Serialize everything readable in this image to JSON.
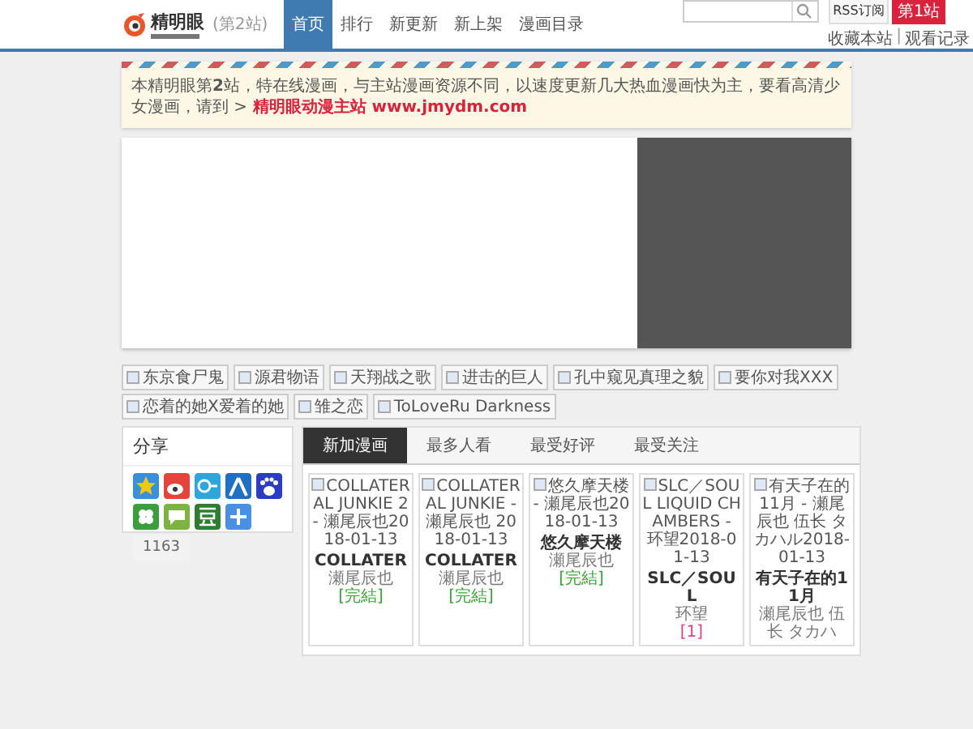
{
  "logo": {
    "name": "精明眼",
    "station": "(第2站)"
  },
  "nav": [
    {
      "label": "首页",
      "selected": true
    },
    {
      "label": "排行",
      "selected": false
    },
    {
      "label": "新更新",
      "selected": false
    },
    {
      "label": "新上架",
      "selected": false
    },
    {
      "label": "漫画目录",
      "selected": false
    }
  ],
  "header_links": {
    "rss": "RSS订阅",
    "station": "第1站",
    "links": [
      "收藏本站",
      "观看记录"
    ],
    "separator": "|"
  },
  "notice": {
    "text": "本精明眼第**2**站，特在线漫画，与主站漫画资源不同，以速度更新几大热血漫画快为主，要看高清少女漫画，请到 >",
    "link": "精明眼动漫主站 www.jmydm.com"
  },
  "strip": [
    "东京食尸鬼",
    "源君物语",
    "天翔战之歌",
    "进击的巨人",
    "孔中窥见真理之貌",
    "要你对我XXX",
    "恋着的她X爱着的她",
    "雏之恋",
    "ToLoveRu Darkness"
  ],
  "share": {
    "title": "分享",
    "icons": [
      {
        "kind": "star"
      },
      {
        "kind": "weibo"
      },
      {
        "kind": "tencent"
      },
      {
        "kind": "renren"
      },
      {
        "kind": "baidu"
      },
      {
        "kind": "clover"
      },
      {
        "kind": "chat"
      },
      {
        "kind": "douban"
      },
      {
        "kind": "plus"
      }
    ],
    "count": "1163"
  },
  "tabs": [
    {
      "label": "新加漫画",
      "selected": true
    },
    {
      "label": "最多人看",
      "selected": false
    },
    {
      "label": "最受好评",
      "selected": false
    },
    {
      "label": "最受关注",
      "selected": false
    }
  ],
  "cards": [
    {
      "alt": "COLLATERAL JUNKIE 2 - 瀬尾辰也2018-01-13",
      "title": "COLLATER",
      "author": "瀬尾辰也",
      "status": "[完結]",
      "kind": "finished"
    },
    {
      "alt": "COLLATERAL JUNKIE - 瀬尾辰也 2018-01-13",
      "title": "COLLATER",
      "author": "瀬尾辰也",
      "status": "[完結]",
      "kind": "finished"
    },
    {
      "alt": "悠久摩天楼 - 瀬尾辰也2018-01-13",
      "title": "悠久摩天楼",
      "author": "瀬尾辰也",
      "status": "[完結]",
      "kind": "finished"
    },
    {
      "alt": "SLC／SOUL LIQUID CHAMBERS - 环望2018-01-13",
      "title": "SLC／SOUL",
      "author": "环望",
      "status": "[1]",
      "kind": "serial"
    },
    {
      "alt": "有天子在的11月 - 瀬尾辰也 伍长 タカハル2018-01-13",
      "title": "有天子在的11月",
      "author": "瀬尾辰也 伍长 タカハ",
      "kind": "none"
    }
  ]
}
